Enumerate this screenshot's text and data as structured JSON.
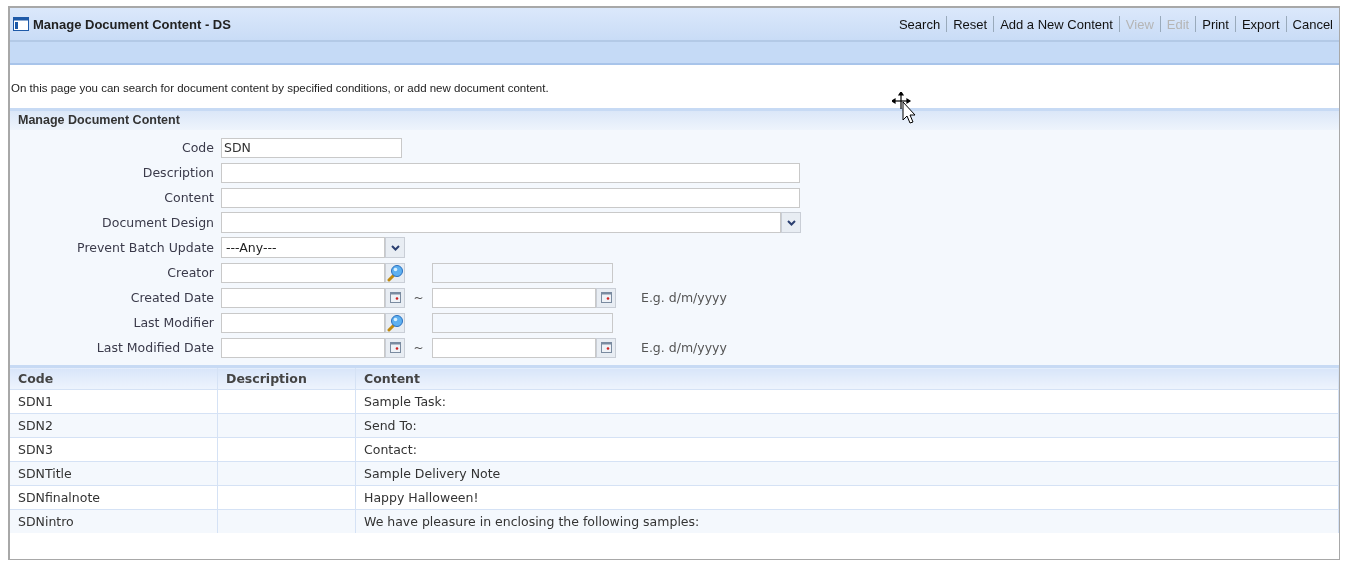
{
  "window": {
    "title": "Manage Document Content - DS"
  },
  "toolbar": [
    {
      "label": "Search",
      "disabled": false
    },
    {
      "label": "Reset",
      "disabled": false
    },
    {
      "label": "Add a New Content",
      "disabled": false
    },
    {
      "label": "View",
      "disabled": true
    },
    {
      "label": "Edit",
      "disabled": true
    },
    {
      "label": "Print",
      "disabled": false
    },
    {
      "label": "Export",
      "disabled": false
    },
    {
      "label": "Cancel",
      "disabled": false
    }
  ],
  "intro": "On this page you can search for document content by specified conditions, or add new document content.",
  "section": {
    "title": "Manage Document Content"
  },
  "fields": [
    {
      "kind": "text",
      "label": "Code",
      "value": "SDN"
    },
    {
      "kind": "wide",
      "label": "Description"
    },
    {
      "kind": "wide",
      "label": "Content"
    },
    {
      "kind": "wideselect",
      "label": "Document Design"
    },
    {
      "kind": "select",
      "label": "Prevent Batch Update",
      "value": "---Any---"
    },
    {
      "kind": "lookup",
      "label": "Creator"
    },
    {
      "kind": "daterange",
      "label": "Created Date",
      "separator": "~",
      "hint": "E.g. d/m/yyyy"
    },
    {
      "kind": "lookup",
      "label": "Last Modifier"
    },
    {
      "kind": "daterange",
      "label": "Last Modified Date",
      "separator": "~",
      "hint": "E.g. d/m/yyyy"
    }
  ],
  "table": {
    "columns": [
      "Code",
      "Description",
      "Content"
    ],
    "rows": [
      [
        "SDN1",
        "",
        "Sample Task:"
      ],
      [
        "SDN2",
        "",
        "Send To:"
      ],
      [
        "SDN3",
        "",
        "Contact:"
      ],
      [
        "SDNTitle",
        "",
        "Sample Delivery Note"
      ],
      [
        "SDNfinalnote",
        "",
        "Happy Halloween!"
      ],
      [
        "SDNintro",
        "",
        "We have pleasure in enclosing the following samples:"
      ]
    ]
  }
}
